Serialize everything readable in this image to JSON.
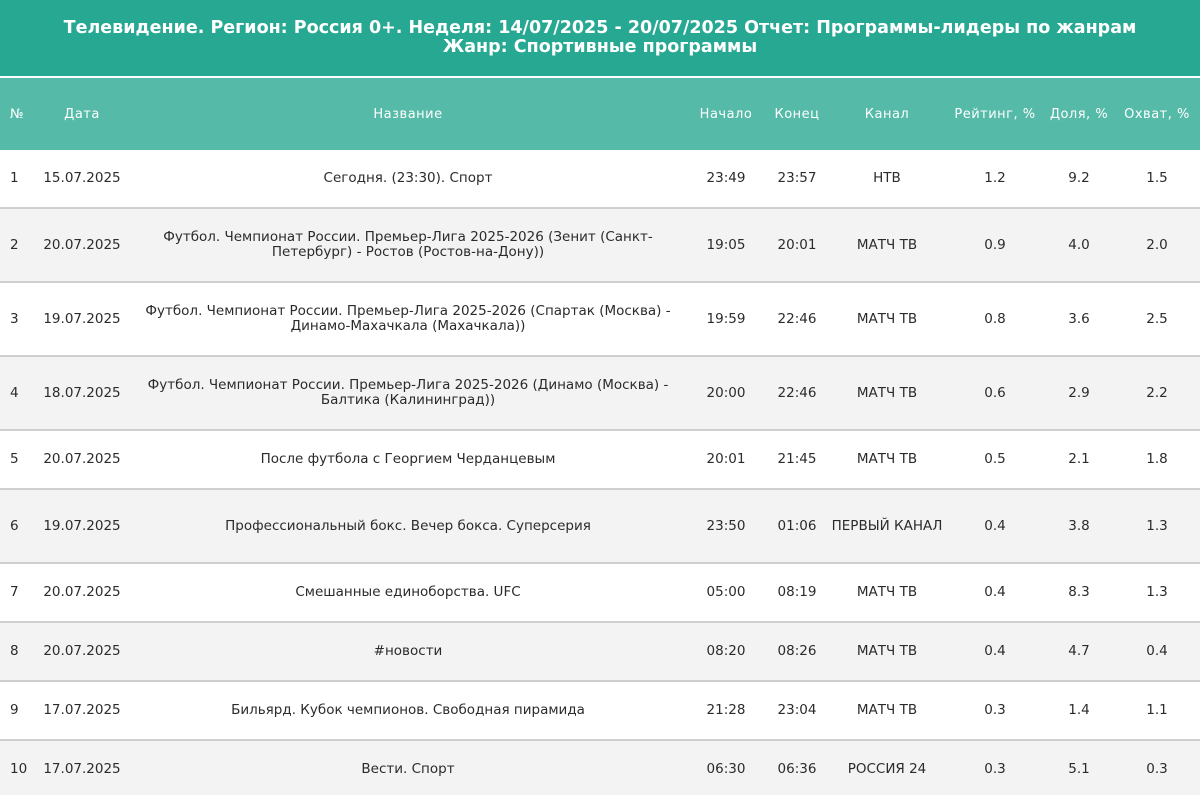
{
  "title": "Телевидение. Регион: Россия 0+. Неделя: 14/07/2025 - 20/07/2025 Отчет: Программы-лидеры по жанрам Жанр: Спортивные программы",
  "colors": {
    "title_bg": "#26a892",
    "header_bg": "#56baa8",
    "row_alt_bg": "#f3f3f3",
    "divider": "#cfcfcf"
  },
  "columns": {
    "num": "№",
    "date": "Дата",
    "name": "Название",
    "start": "Начало",
    "end": "Конец",
    "channel": "Канал",
    "rating": "Рейтинг, %",
    "share": "Доля, %",
    "reach": "Охват, %"
  },
  "rows": [
    {
      "num": "1",
      "date": "15.07.2025",
      "name": "Сегодня. (23:30). Спорт",
      "start": "23:49",
      "end": "23:57",
      "channel": "НТВ",
      "rating": "1.2",
      "share": "9.2",
      "reach": "1.5"
    },
    {
      "num": "2",
      "date": "20.07.2025",
      "name": "Футбол. Чемпионат России. Премьер-Лига 2025-2026 (Зенит (Санкт-Петербург) - Ростов (Ростов-на-Дону))",
      "start": "19:05",
      "end": "20:01",
      "channel": "МАТЧ ТВ",
      "rating": "0.9",
      "share": "4.0",
      "reach": "2.0"
    },
    {
      "num": "3",
      "date": "19.07.2025",
      "name": "Футбол. Чемпионат России. Премьер-Лига 2025-2026 (Спартак (Москва) - Динамо-Махачкала (Махачкала))",
      "start": "19:59",
      "end": "22:46",
      "channel": "МАТЧ ТВ",
      "rating": "0.8",
      "share": "3.6",
      "reach": "2.5"
    },
    {
      "num": "4",
      "date": "18.07.2025",
      "name": "Футбол. Чемпионат России. Премьер-Лига 2025-2026 (Динамо (Москва) - Балтика (Калининград))",
      "start": "20:00",
      "end": "22:46",
      "channel": "МАТЧ ТВ",
      "rating": "0.6",
      "share": "2.9",
      "reach": "2.2"
    },
    {
      "num": "5",
      "date": "20.07.2025",
      "name": "После футбола с Георгием Черданцевым",
      "start": "20:01",
      "end": "21:45",
      "channel": "МАТЧ ТВ",
      "rating": "0.5",
      "share": "2.1",
      "reach": "1.8"
    },
    {
      "num": "6",
      "date": "19.07.2025",
      "name": "Профессиональный бокс. Вечер бокса. Суперсерия",
      "start": "23:50",
      "end": "01:06",
      "channel": "ПЕРВЫЙ КАНАЛ",
      "rating": "0.4",
      "share": "3.8",
      "reach": "1.3"
    },
    {
      "num": "7",
      "date": "20.07.2025",
      "name": "Смешанные единоборства. UFC",
      "start": "05:00",
      "end": "08:19",
      "channel": "МАТЧ ТВ",
      "rating": "0.4",
      "share": "8.3",
      "reach": "1.3"
    },
    {
      "num": "8",
      "date": "20.07.2025",
      "name": "#новости",
      "start": "08:20",
      "end": "08:26",
      "channel": "МАТЧ ТВ",
      "rating": "0.4",
      "share": "4.7",
      "reach": "0.4"
    },
    {
      "num": "9",
      "date": "17.07.2025",
      "name": "Бильярд. Кубок чемпионов. Свободная пирамида",
      "start": "21:28",
      "end": "23:04",
      "channel": "МАТЧ ТВ",
      "rating": "0.3",
      "share": "1.4",
      "reach": "1.1"
    },
    {
      "num": "10",
      "date": "17.07.2025",
      "name": "Вести. Спорт",
      "start": "06:30",
      "end": "06:36",
      "channel": "РОССИЯ 24",
      "rating": "0.3",
      "share": "5.1",
      "reach": "0.3"
    }
  ]
}
